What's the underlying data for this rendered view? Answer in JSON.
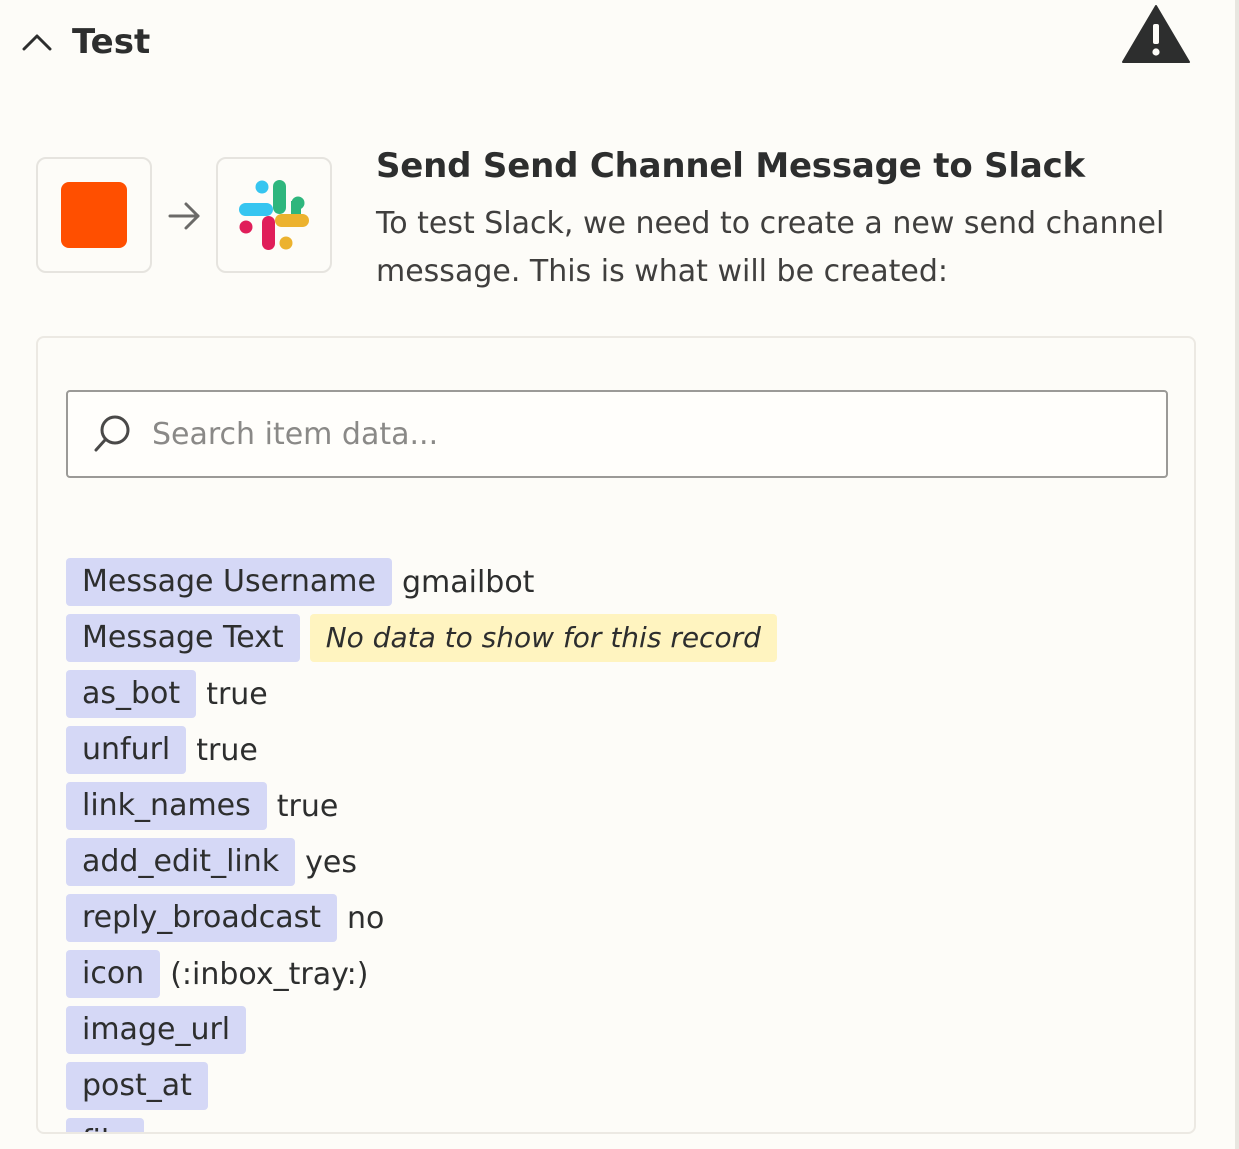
{
  "header": {
    "title": "Test",
    "collapse_icon": "chevron-up-icon",
    "warning_icon": "warning-icon"
  },
  "step": {
    "source_icon": "orange-square-icon",
    "arrow_icon": "arrow-right-icon",
    "target_icon": "slack-logo-icon",
    "title": "Send Send Channel Message to Slack",
    "description": "To test Slack, we need to create a new send channel message. This is what will be created:"
  },
  "search": {
    "placeholder": "Search item data...",
    "icon": "search-icon"
  },
  "fields": [
    {
      "key": "Message Username",
      "value": "gmailbot"
    },
    {
      "key": "Message Text",
      "empty_text": "No data to show for this record"
    },
    {
      "key": "as_bot",
      "value": "true"
    },
    {
      "key": "unfurl",
      "value": "true"
    },
    {
      "key": "link_names",
      "value": "true"
    },
    {
      "key": "add_edit_link",
      "value": "yes"
    },
    {
      "key": "reply_broadcast",
      "value": "no"
    },
    {
      "key": "icon",
      "value": "(:inbox_tray:)"
    },
    {
      "key": "image_url",
      "value": ""
    },
    {
      "key": "post_at",
      "value": ""
    },
    {
      "key": "file",
      "value": ""
    }
  ],
  "colors": {
    "zapier_orange": "#ff4f00",
    "key_chip": "#d5d8f6",
    "empty_chip": "#fff4c0",
    "background": "#fdfcf8"
  }
}
